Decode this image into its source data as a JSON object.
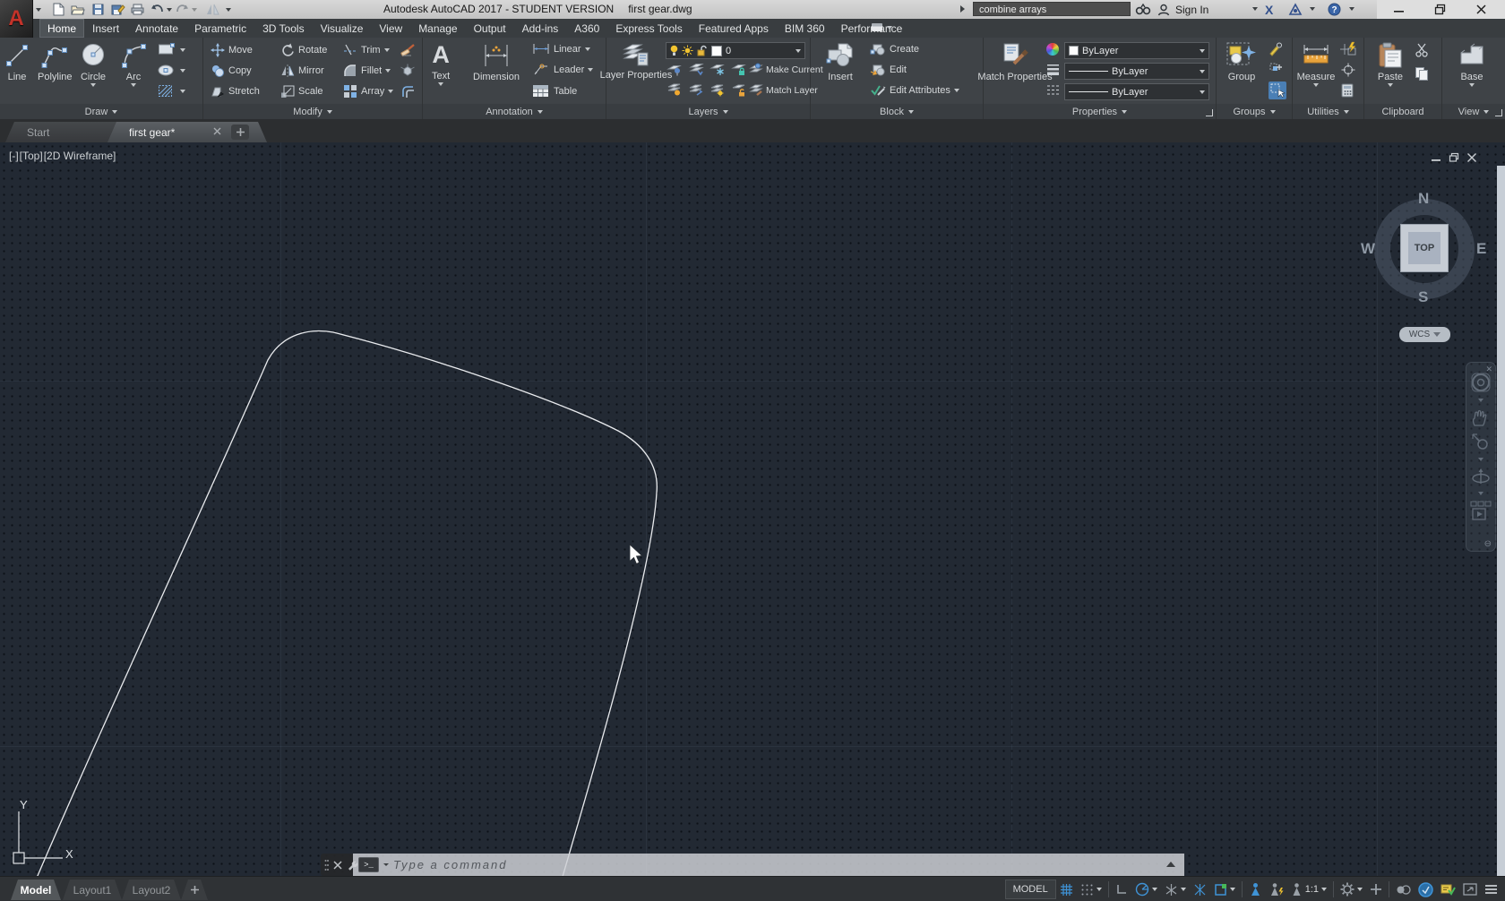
{
  "window": {
    "logo": "A",
    "app_title": "Autodesk AutoCAD 2017 - STUDENT VERSION",
    "doc_name": "first gear.dwg",
    "search_value": "combine arrays",
    "sign_in": "Sign In",
    "exchange": "X",
    "help": "?"
  },
  "ribbon": {
    "tabs": [
      "Home",
      "Insert",
      "Annotate",
      "Parametric",
      "3D Tools",
      "Visualize",
      "View",
      "Manage",
      "Output",
      "Add-ins",
      "A360",
      "Express Tools",
      "Featured Apps",
      "BIM 360",
      "Performance"
    ],
    "active_tab": "Home",
    "draw": {
      "label": "Draw",
      "line": "Line",
      "polyline": "Polyline",
      "circle": "Circle",
      "arc": "Arc"
    },
    "modify": {
      "label": "Modify",
      "move": "Move",
      "copy": "Copy",
      "stretch": "Stretch",
      "rotate": "Rotate",
      "mirror": "Mirror",
      "scale": "Scale",
      "trim": "Trim",
      "fillet": "Fillet",
      "array": "Array"
    },
    "annotation": {
      "label": "Annotation",
      "text": "Text",
      "text_glyph": "A",
      "dimension": "Dimension",
      "linear": "Linear",
      "leader": "Leader",
      "table": "Table"
    },
    "layers": {
      "label": "Layers",
      "layer_properties": "Layer Properties",
      "current_layer": "0",
      "make_current": "Make Current",
      "match_layer": "Match Layer"
    },
    "block": {
      "label": "Block",
      "insert": "Insert",
      "create": "Create",
      "edit": "Edit",
      "edit_attributes": "Edit Attributes"
    },
    "properties": {
      "label": "Properties",
      "match_properties": "Match Properties",
      "color": "ByLayer",
      "lineweight": "ByLayer",
      "linetype": "ByLayer"
    },
    "groups": {
      "label": "Groups",
      "group": "Group"
    },
    "utilities": {
      "label": "Utilities",
      "measure": "Measure"
    },
    "clipboard": {
      "label": "Clipboard",
      "paste": "Paste"
    },
    "view": {
      "label": "View",
      "base": "Base"
    }
  },
  "file_tabs": {
    "start": "Start",
    "drawing": "first gear*"
  },
  "viewport": {
    "minimized": "[-]",
    "view": "[Top]",
    "visual_style": "[2D Wireframe]"
  },
  "viewcube": {
    "north": "N",
    "south": "S",
    "east": "E",
    "west": "W",
    "face": "TOP",
    "wcs": "WCS"
  },
  "canvas": {
    "ucs_x": "X",
    "ucs_y": "Y"
  },
  "command": {
    "prompt": ">_",
    "placeholder": "Type a command"
  },
  "layout_tabs": {
    "model": "Model",
    "layout1": "Layout1",
    "layout2": "Layout2"
  },
  "status": {
    "model": "MODEL",
    "annotation_scale": "1:1"
  },
  "colors": {
    "accent_blue": "#3f93d6",
    "canvas_bg": "#222933",
    "ribbon_bg": "#3f4347",
    "titlebar_bg": "#cacaca",
    "drawing_line": "#e9ebee"
  }
}
